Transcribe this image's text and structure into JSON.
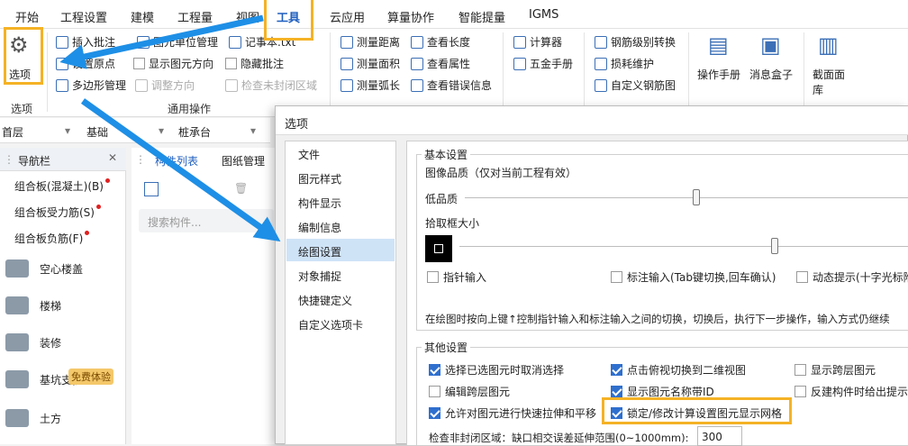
{
  "menubar": {
    "items": [
      "开始",
      "工程设置",
      "建模",
      "工程量",
      "视图",
      "工具",
      "云应用",
      "算量协作",
      "智能提量",
      "IGMS"
    ]
  },
  "ribbon": {
    "options_label": "选项",
    "options_group": "选项",
    "general_ops": {
      "label": "通用操作",
      "items": [
        "插入批注",
        "图元单位管理",
        "记事本.txt",
        "设置原点",
        "显示图元方向",
        "隐藏批注",
        "多边形管理",
        "调整方向",
        "检查未封闭区域"
      ]
    },
    "measure": {
      "items": [
        "测量距离",
        "测量面积",
        "测量弧长",
        "查看长度",
        "查看属性",
        "查看错误信息"
      ]
    },
    "tools": {
      "items": [
        "计算器",
        "五金手册"
      ]
    },
    "rebar": {
      "items": [
        "钢筋级别转换",
        "损耗维护",
        "自定义钢筋图"
      ]
    },
    "big_buttons": [
      "操作手册",
      "消息盒子",
      "截面面库"
    ]
  },
  "subbar": {
    "floor": "首层",
    "category": "基础",
    "type": "桩承台"
  },
  "nav": {
    "title": "导航栏",
    "items": [
      "组合板(混凝土)(B)",
      "组合板受力筋(S)",
      "组合板负筋(F)"
    ],
    "categories": [
      "空心楼盖",
      "楼梯",
      "装修",
      "基坑支护",
      "土方"
    ],
    "promo_badge": "免费体验"
  },
  "midpanel": {
    "tabs": [
      "构件列表",
      "图纸管理"
    ],
    "search_placeholder": "搜索构件..."
  },
  "dialog": {
    "title": "选项",
    "list": [
      "文件",
      "图元样式",
      "构件显示",
      "编制信息",
      "绘图设置",
      "对象捕捉",
      "快捷键定义",
      "自定义选项卡"
    ],
    "selected_index": 4,
    "basic": {
      "title": "基本设置",
      "quality_label": "图像品质（仅对当前工程有效）",
      "low_label": "低品质",
      "pick_label": "拾取框大小",
      "quality_value": 0.52,
      "pick_value": 0.7,
      "pointer_input": "指针输入",
      "tag_input": "标注输入(Tab键切换,回车确认)",
      "dynamic_hint": "动态提示(十字光标附",
      "note": "在绘图时按向上键↑控制指针输入和标注输入之间的切换，切换后，执行下一步操作，输入方式仍继续"
    },
    "other": {
      "title": "其他设置",
      "options": [
        {
          "label": "选择已选图元时取消选择",
          "checked": true
        },
        {
          "label": "点击俯视切换到二维视图",
          "checked": true
        },
        {
          "label": "显示跨层图元",
          "checked": false
        },
        {
          "label": "编辑跨层图元",
          "checked": false
        },
        {
          "label": "显示图元名称带ID",
          "checked": true
        },
        {
          "label": "反建构件时给出提示",
          "checked": false
        },
        {
          "label": "允许对图元进行快速拉伸和平移",
          "checked": true
        },
        {
          "label": "锁定/修改计算设置图元显示网格",
          "checked": true
        }
      ],
      "gap_label": "检查非封闭区域：缺口相交误差延伸范围(0~1000mm):",
      "gap_value": "300"
    }
  },
  "colors": {
    "highlight": "#f5b226",
    "arrow": "#1e8fe6",
    "accent": "#2f6fce"
  }
}
